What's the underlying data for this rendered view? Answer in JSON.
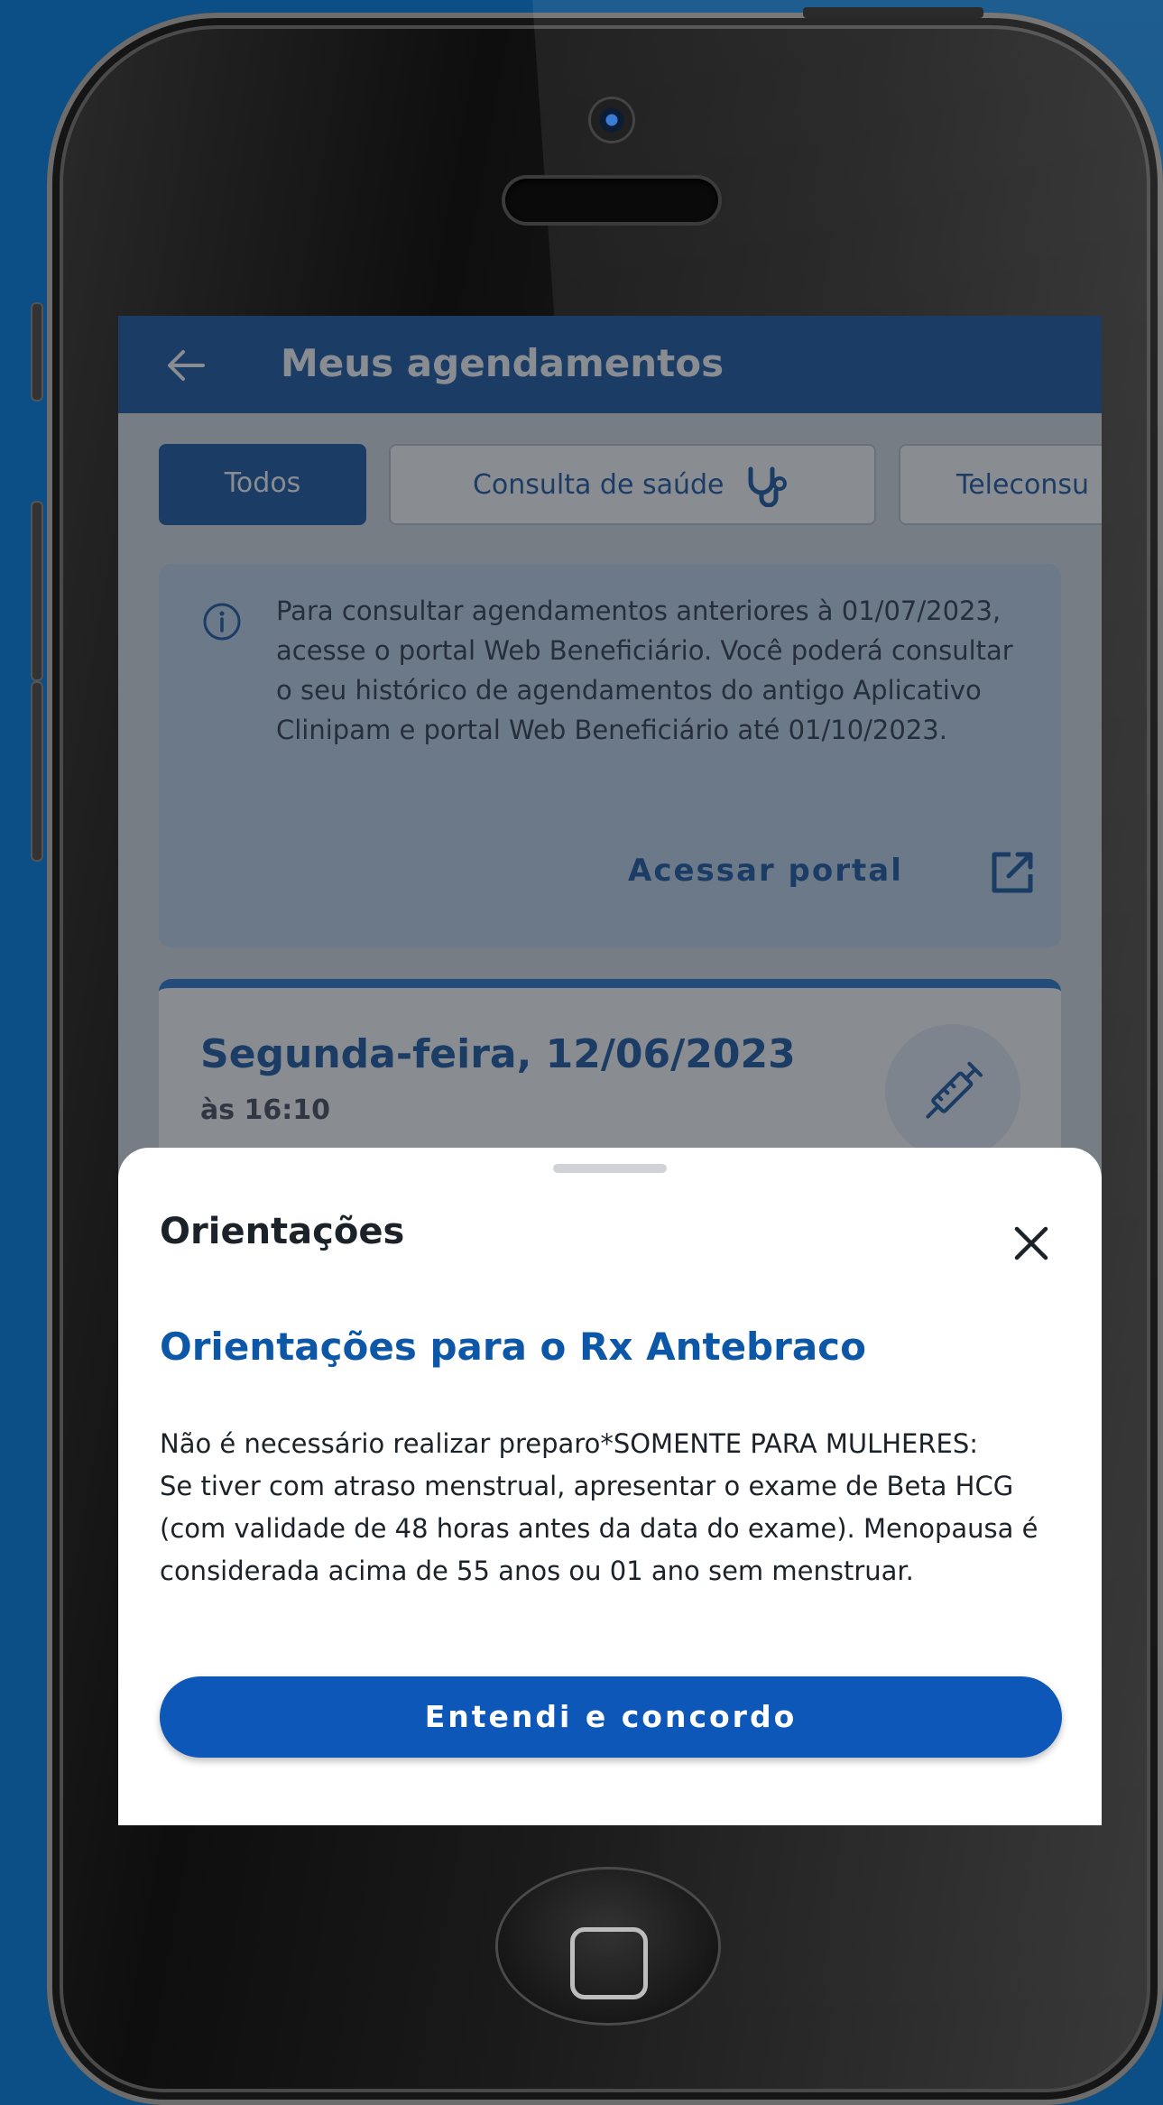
{
  "colors": {
    "background": "#0b4f86",
    "brand_blue": "#0d4f9e",
    "info_card": "#bcd6ee",
    "button_blue": "#0d57b8"
  },
  "appbar": {
    "back_icon": "arrow-left-icon",
    "title": "Meus agendamentos"
  },
  "filters": {
    "items": [
      {
        "label": "Todos",
        "active": true
      },
      {
        "label": "Consulta de saúde",
        "icon": "stethoscope-icon",
        "active": false
      },
      {
        "label": "Teleconsu",
        "active": false
      }
    ]
  },
  "info_card": {
    "icon": "info-icon",
    "text": "Para consultar agendamentos anteriores à 01/07/2023,  acesse o portal Web Beneficiário. Você poderá consultar o seu histórico de agendamentos do antigo Aplicativo Clinipam e portal Web Beneficiário até 01/10/2023.",
    "link_label": "Acessar portal",
    "link_icon": "external-link-icon"
  },
  "appointment": {
    "date": "Segunda-feira, 12/06/2023",
    "time": "às 16:10",
    "icon": "syringe-icon"
  },
  "sheet": {
    "title": "Orientações",
    "close_icon": "close-icon",
    "subtitle": "Orientações para o Rx Antebraco",
    "body": "Não é necessário realizar preparo*SOMENTE PARA MULHERES:\nSe tiver com atraso menstrual, apresentar o exame de Beta HCG (com validade de 48 horas antes da data do exame). Menopausa é considerada acima de 55 anos ou 01 ano sem menstruar.",
    "button_label": "Entendi e concordo"
  }
}
